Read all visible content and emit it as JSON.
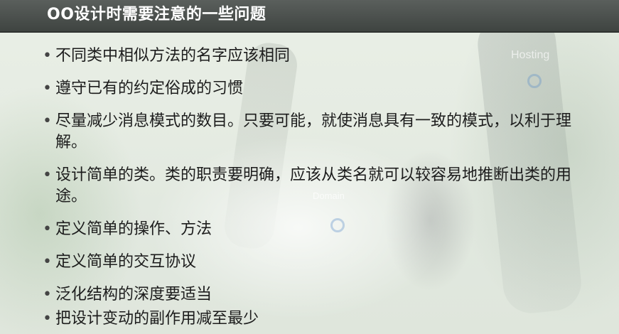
{
  "slide": {
    "title": "OO设计时需要注意的一些问题",
    "background_labels": {
      "hosting": "Hosting",
      "domain": "Domain"
    },
    "bullets": [
      {
        "text": "不同类中相似方法的名字应该相同"
      },
      {
        "text": "遵守已有的约定俗成的习惯"
      },
      {
        "text": "尽量减少消息模式的数目。只要可能，就使消息具有一致的模式，以利于理解。"
      },
      {
        "text": "设计简单的类。类的职责要明确，应该从类名就可以较容易地推断出类的用途。"
      },
      {
        "text": "定义简单的操作、方法"
      },
      {
        "text": "定义简单的交互协议"
      },
      {
        "text": "泛化结构的深度要适当"
      },
      {
        "text": "把设计变动的副作用减至最少"
      }
    ],
    "bullet_glyph": "•",
    "colors": {
      "title_bar": "#4a4f4c",
      "title_text": "#ffffff",
      "body_text": "#1c1c1c"
    }
  }
}
